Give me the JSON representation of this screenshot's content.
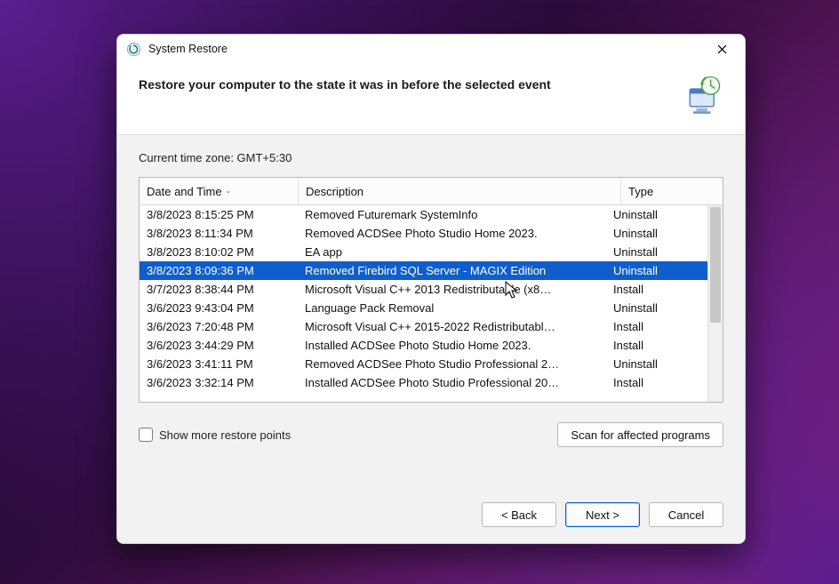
{
  "window": {
    "title": "System Restore"
  },
  "header": {
    "heading": "Restore your computer to the state it was in before the selected event"
  },
  "timezone_label": "Current time zone: GMT+5:30",
  "table": {
    "columns": {
      "date": "Date and Time",
      "description": "Description",
      "type": "Type"
    },
    "selected_index": 3,
    "rows": [
      {
        "date": "3/8/2023 8:15:25 PM",
        "description": "Removed Futuremark SystemInfo",
        "type": "Uninstall"
      },
      {
        "date": "3/8/2023 8:11:34 PM",
        "description": "Removed ACDSee Photo Studio Home 2023.",
        "type": "Uninstall"
      },
      {
        "date": "3/8/2023 8:10:02 PM",
        "description": "EA app",
        "type": "Uninstall"
      },
      {
        "date": "3/8/2023 8:09:36 PM",
        "description": "Removed Firebird SQL Server - MAGIX Edition",
        "type": "Uninstall"
      },
      {
        "date": "3/7/2023 8:38:44 PM",
        "description": "Microsoft Visual C++ 2013 Redistributable (x8…",
        "type": "Install"
      },
      {
        "date": "3/6/2023 9:43:04 PM",
        "description": "Language Pack Removal",
        "type": "Uninstall"
      },
      {
        "date": "3/6/2023 7:20:48 PM",
        "description": "Microsoft Visual C++ 2015-2022 Redistributabl…",
        "type": "Install"
      },
      {
        "date": "3/6/2023 3:44:29 PM",
        "description": "Installed ACDSee Photo Studio Home 2023.",
        "type": "Install"
      },
      {
        "date": "3/6/2023 3:41:11 PM",
        "description": "Removed ACDSee Photo Studio Professional 2…",
        "type": "Uninstall"
      },
      {
        "date": "3/6/2023 3:32:14 PM",
        "description": "Installed ACDSee Photo Studio Professional 20…",
        "type": "Install"
      }
    ]
  },
  "controls": {
    "show_more_label": "Show more restore points",
    "scan_label": "Scan for affected programs",
    "back_label": "< Back",
    "next_label": "Next >",
    "cancel_label": "Cancel"
  }
}
